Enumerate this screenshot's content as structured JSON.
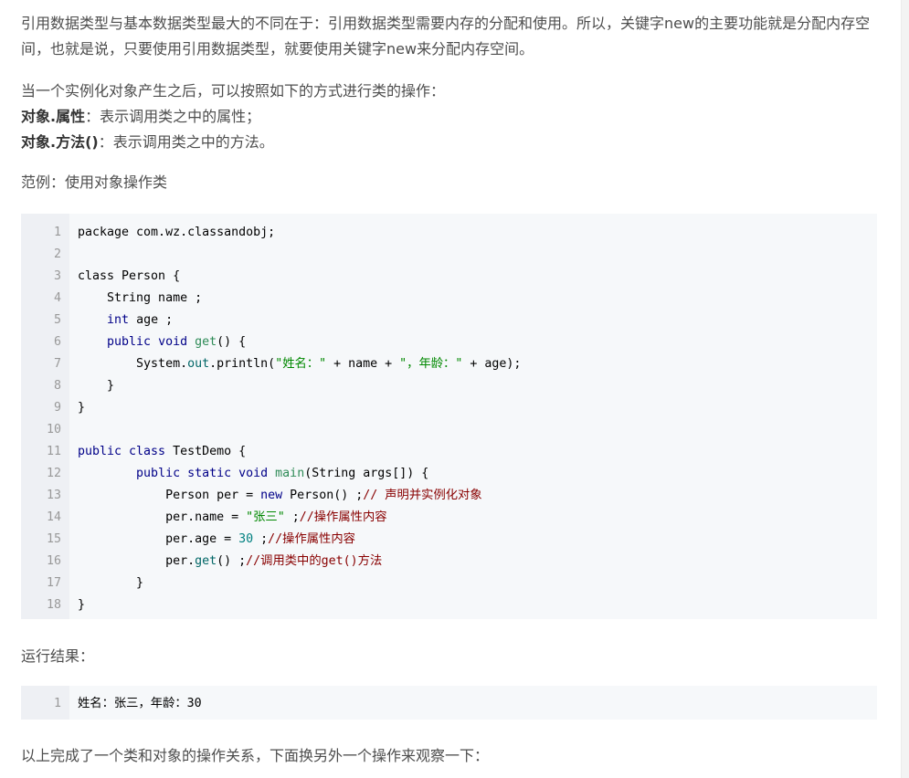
{
  "paragraphs": {
    "intro": "引用数据类型与基本数据类型最大的不同在于：引用数据类型需要内存的分配和使用。所以，关键字new的主要功能就是分配内存空间，也就是说，只要使用引用数据类型，就要使用关键字new来分配内存空间。",
    "ops_intro": "当一个实例化对象产生之后，可以按照如下的方式进行类的操作：",
    "op1_term": "对象.属性",
    "op1_desc": "：表示调用类之中的属性；",
    "op2_term": "对象.方法()",
    "op2_desc": "：表示调用类之中的方法。",
    "example_label": "范例：使用对象操作类",
    "result_label": "运行结果：",
    "outro": "以上完成了一个类和对象的操作关系，下面换另外一个操作来观察一下："
  },
  "code": {
    "line_numbers": [
      "1",
      "2",
      "3",
      "4",
      "5",
      "6",
      "7",
      "8",
      "9",
      "10",
      "11",
      "12",
      "13",
      "14",
      "15",
      "16",
      "17",
      "18"
    ],
    "lines": [
      [
        {
          "t": "package com.wz.classandobj;",
          "c": "typ"
        }
      ],
      [],
      [
        {
          "t": "class Person {",
          "c": "typ"
        }
      ],
      [
        {
          "t": "    String name ;",
          "c": "typ"
        }
      ],
      [
        {
          "t": "    ",
          "c": "typ"
        },
        {
          "t": "int",
          "c": "kw"
        },
        {
          "t": " age ;",
          "c": "typ"
        }
      ],
      [
        {
          "t": "    ",
          "c": "typ"
        },
        {
          "t": "public void",
          "c": "kw"
        },
        {
          "t": " ",
          "c": "typ"
        },
        {
          "t": "get",
          "c": "fn"
        },
        {
          "t": "() {",
          "c": "typ"
        }
      ],
      [
        {
          "t": "        System.",
          "c": "typ"
        },
        {
          "t": "out",
          "c": "mth"
        },
        {
          "t": ".println(",
          "c": "typ"
        },
        {
          "t": "\"姓名：\"",
          "c": "str"
        },
        {
          "t": " + name + ",
          "c": "typ"
        },
        {
          "t": "\"，年龄：\"",
          "c": "str"
        },
        {
          "t": " + age);",
          "c": "typ"
        }
      ],
      [
        {
          "t": "    }",
          "c": "typ"
        }
      ],
      [
        {
          "t": "}",
          "c": "typ"
        }
      ],
      [],
      [
        {
          "t": "public class",
          "c": "kw"
        },
        {
          "t": " TestDemo {",
          "c": "typ"
        }
      ],
      [
        {
          "t": "        ",
          "c": "typ"
        },
        {
          "t": "public static void",
          "c": "kw"
        },
        {
          "t": " ",
          "c": "typ"
        },
        {
          "t": "main",
          "c": "fn"
        },
        {
          "t": "(String args[]) {",
          "c": "typ"
        }
      ],
      [
        {
          "t": "            Person per = ",
          "c": "typ"
        },
        {
          "t": "new",
          "c": "kw"
        },
        {
          "t": " Person() ;",
          "c": "typ"
        },
        {
          "t": "// 声明并实例化对象",
          "c": "cm"
        }
      ],
      [
        {
          "t": "            per.name = ",
          "c": "typ"
        },
        {
          "t": "\"张三\"",
          "c": "str"
        },
        {
          "t": " ;",
          "c": "typ"
        },
        {
          "t": "//操作属性内容",
          "c": "cm"
        }
      ],
      [
        {
          "t": "            per.age = ",
          "c": "typ"
        },
        {
          "t": "30",
          "c": "num"
        },
        {
          "t": " ;",
          "c": "typ"
        },
        {
          "t": "//操作属性内容",
          "c": "cm"
        }
      ],
      [
        {
          "t": "            per.",
          "c": "typ"
        },
        {
          "t": "get",
          "c": "mth"
        },
        {
          "t": "() ;",
          "c": "typ"
        },
        {
          "t": "//调用类中的get()方法",
          "c": "cm"
        }
      ],
      [
        {
          "t": "        }",
          "c": "typ"
        }
      ],
      [
        {
          "t": "}",
          "c": "typ"
        }
      ]
    ]
  },
  "result": {
    "line_numbers": [
      "1"
    ],
    "lines": [
      [
        {
          "t": "姓名：张三，年龄：30",
          "c": "typ"
        }
      ]
    ]
  },
  "colors": {
    "keyword": "#000088",
    "string": "#008800",
    "comment": "#880000",
    "number": "#008080",
    "code_bg": "#f6f8fa",
    "gutter_bg": "#eef0f4"
  }
}
